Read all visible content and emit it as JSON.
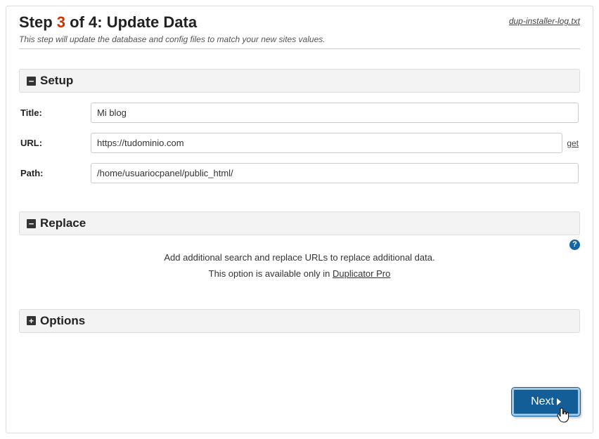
{
  "header": {
    "step_prefix": "Step ",
    "step_num": "3",
    "step_of": " of 4: ",
    "step_name": "Update Data",
    "subtitle": "This step will update the database and config files to match your new sites values.",
    "log_link": "dup-installer-log.txt"
  },
  "setup": {
    "title": "Setup",
    "fields": {
      "title": {
        "label": "Title:",
        "value": "Mi blog"
      },
      "url": {
        "label": "URL:",
        "value": "https://tudominio.com",
        "get": "get"
      },
      "path": {
        "label": "Path:",
        "value": "/home/usuariocpanel/public_html/"
      }
    }
  },
  "replace": {
    "title": "Replace",
    "line1": "Add additional search and replace URLs to replace additional data.",
    "line2_prefix": "This option is available only in ",
    "pro_link": "Duplicator Pro"
  },
  "options": {
    "title": "Options"
  },
  "buttons": {
    "next": "Next"
  }
}
